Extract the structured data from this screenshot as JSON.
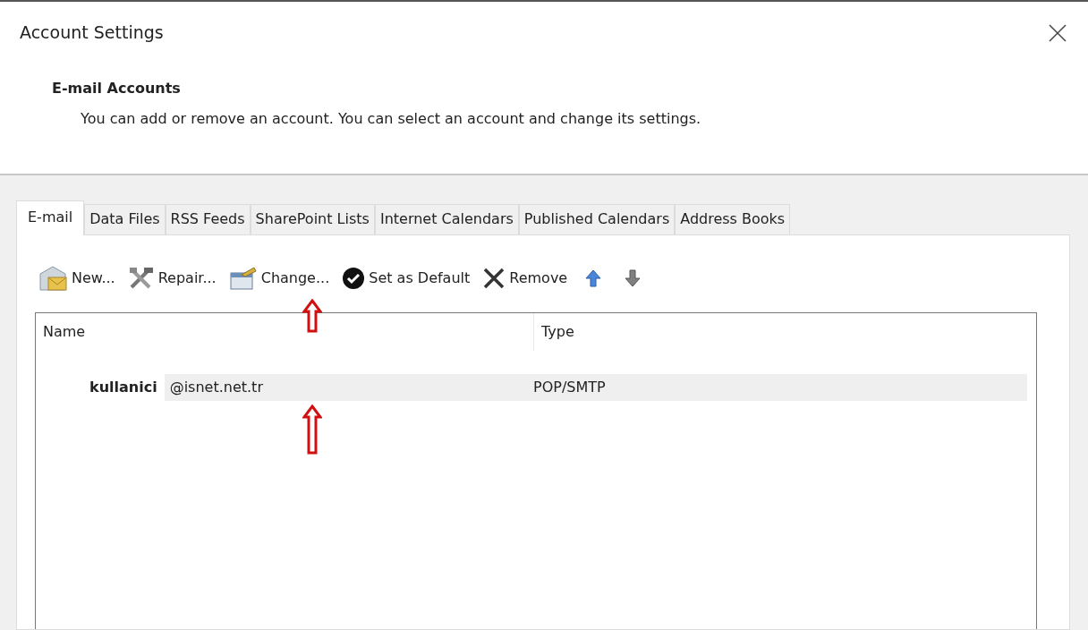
{
  "window": {
    "title": "Account Settings"
  },
  "heading": "E-mail Accounts",
  "description": "You can add or remove an account. You can select an account and change its settings.",
  "tabs": [
    {
      "label": "E-mail",
      "selected": true
    },
    {
      "label": "Data Files",
      "selected": false
    },
    {
      "label": "RSS Feeds",
      "selected": false
    },
    {
      "label": "SharePoint Lists",
      "selected": false
    },
    {
      "label": "Internet Calendars",
      "selected": false
    },
    {
      "label": "Published Calendars",
      "selected": false
    },
    {
      "label": "Address Books",
      "selected": false
    }
  ],
  "toolbar": [
    {
      "kind": "new",
      "label": "New..."
    },
    {
      "kind": "repair",
      "label": "Repair..."
    },
    {
      "kind": "change",
      "label": "Change..."
    },
    {
      "kind": "default",
      "label": "Set as Default"
    },
    {
      "kind": "remove",
      "label": "Remove"
    },
    {
      "kind": "up"
    },
    {
      "kind": "down"
    }
  ],
  "table": {
    "columns": [
      "Name",
      "Type"
    ],
    "rows": [
      {
        "user": "kullanici",
        "domain": "@isnet.net.tr",
        "type": "POP/SMTP",
        "selected": true
      }
    ]
  },
  "annotations": [
    {
      "kind": "short-arrow"
    },
    {
      "kind": "long-arrow"
    }
  ]
}
